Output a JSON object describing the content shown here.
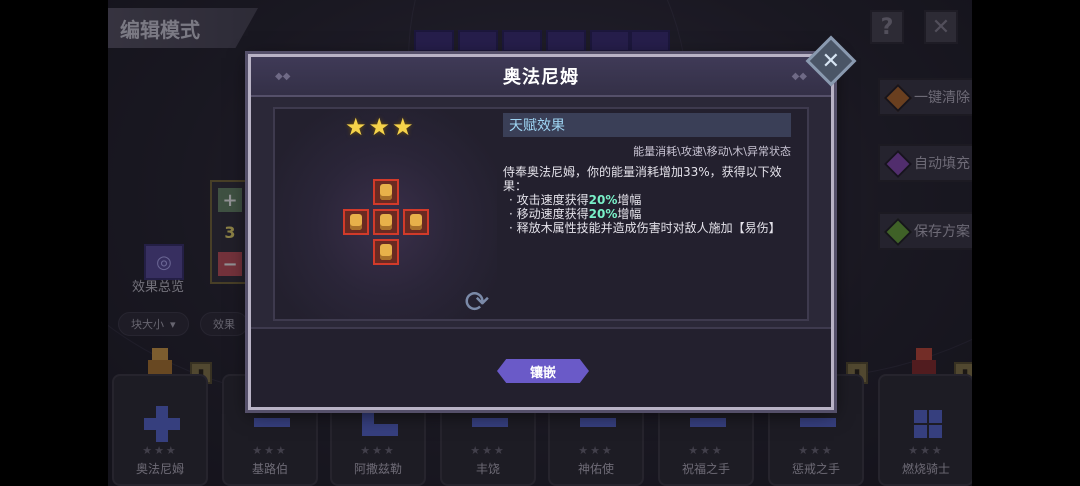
{
  "header": {
    "mode_title": "编辑模式",
    "help_icon": "question-mark-icon",
    "close_icon": "close-x-icon"
  },
  "side_buttons": [
    {
      "label": "一键清除",
      "gem_color": "#b86a2a"
    },
    {
      "label": "自动填充",
      "gem_color": "#8a4ab8"
    },
    {
      "label": "保存方案",
      "gem_color": "#6aa83a"
    }
  ],
  "left_panel": {
    "count": "3",
    "overview_label": "效果总览",
    "filters": [
      "块大小",
      "效果"
    ]
  },
  "cards": [
    {
      "name": "奥法尼姆"
    },
    {
      "name": "基路伯"
    },
    {
      "name": "阿撒兹勒"
    },
    {
      "name": "丰饶"
    },
    {
      "name": "神佑使"
    },
    {
      "name": "祝福之手"
    },
    {
      "name": "惩戒之手"
    },
    {
      "name": "燃烧骑士"
    }
  ],
  "modal": {
    "title": "奥法尼姆",
    "stars": "★★★",
    "talent_header": "天赋效果",
    "tags": "能量消耗\\攻速\\移动\\木\\异常状态",
    "description": "侍奉奥法尼姆，你的能量消耗增加33%，获得以下效果：",
    "bullets": [
      {
        "pre": "· 攻击速度获得",
        "value": "20%",
        "post": "增幅"
      },
      {
        "pre": "· 移动速度获得",
        "value": "20%",
        "post": "增幅"
      },
      {
        "pre": "· 释放木属性技能并造成伤害时对敌人施加【易伤】",
        "value": "",
        "post": ""
      }
    ],
    "inlay_button": "镶嵌",
    "accent": "#6a5ac8"
  }
}
